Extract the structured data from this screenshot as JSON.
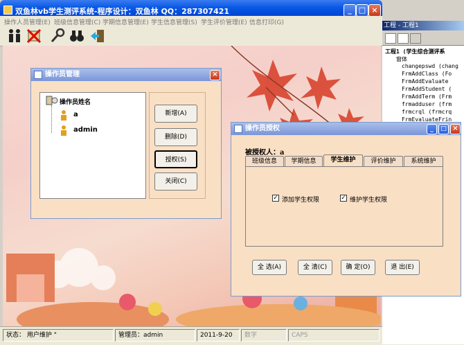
{
  "main": {
    "title": "双鱼林vb学生测评系统-程序设计：双鱼林  QQ：287307421",
    "menu": [
      "操作人员管理(E)",
      "班级信息管理(C)",
      "学期信息管理(E)",
      "学生信息管理(S)",
      "学生评价管理(E)",
      "信息打印(G)"
    ],
    "status": {
      "state": "状态：  用户维护 \"",
      "operator": "管理员：admin",
      "date": "2011-9-20",
      "num": "数字",
      "caps": "CAPS"
    }
  },
  "ide": {
    "title": "工程 - 工程1",
    "tree": [
      "工程1 (学生综合测评系",
      "窗体",
      "changepswd (chang",
      "FrmAddClass (Fo",
      "FrmAddEvaluate",
      "FrmAddStudent (",
      "FrmAddTerm (Frm",
      "frmadduser (frm",
      "frmcrql (frmcrq",
      "FrmEvaluateFrin"
    ]
  },
  "operator_dialog": {
    "title": "操作员管理",
    "root": "操作员姓名",
    "users": [
      "a",
      "admin"
    ],
    "buttons": [
      "新增(A)",
      "删除(D)",
      "授权(S)",
      "关闭(C)"
    ]
  },
  "auth_dialog": {
    "title": "操作员授权",
    "label": "被授权人：a",
    "tabs": [
      "班级信息",
      "学期信息",
      "学生维护",
      "评价维护",
      "系统维护"
    ],
    "selected_tab": 2,
    "checkboxes": [
      {
        "label": "添加学生权限",
        "checked": true
      },
      {
        "label": "维护学生权限",
        "checked": true
      }
    ],
    "buttons": [
      "全 选(A)",
      "全 清(C)",
      "确 定(O)",
      "退 出(E)"
    ]
  }
}
